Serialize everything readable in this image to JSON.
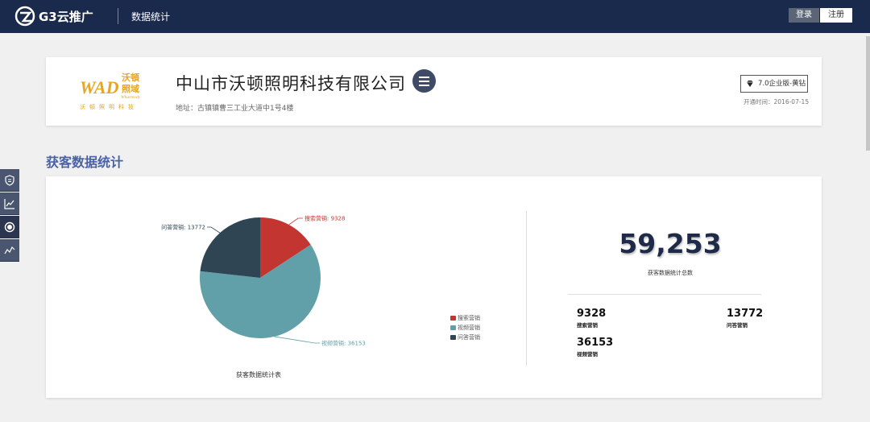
{
  "header": {
    "brand": "G3云推广",
    "page_title": "数据统计",
    "login_label": "登录",
    "register_label": "注册"
  },
  "company": {
    "logo_text_brand": "WAD",
    "logo_text_cn": "沃頓照明科技",
    "logo_text_side": "沃頓 照域",
    "logo_text_en": "Wharteody",
    "name": "中山市沃顿照明科技有限公司",
    "address": "地址：古镇镇曹三工业大道中1号4楼",
    "version": "7.0企业版-黄钻",
    "open_date": "开通时间：2016-07-15"
  },
  "sidebar": {
    "tabs": [
      {
        "icon": "shield-icon"
      },
      {
        "icon": "line-chart-icon"
      },
      {
        "icon": "target-icon"
      },
      {
        "icon": "trend-icon"
      }
    ]
  },
  "section": {
    "title": "获客数据统计"
  },
  "chart_data": {
    "type": "pie",
    "caption": "获客数据统计表",
    "slices": [
      {
        "name": "搜索营销",
        "value": 9328,
        "color": "#c23531",
        "label": "搜索营销: 9328"
      },
      {
        "name": "视频营销",
        "value": 36153,
        "color": "#61a0a8",
        "label": "视频营销: 36153"
      },
      {
        "name": "问答营销",
        "value": 13772,
        "color": "#2f4554",
        "label": "问答营销: 13772"
      }
    ],
    "legend": [
      "搜索营销",
      "视频营销",
      "问答营销"
    ],
    "legend_position": "right-bottom"
  },
  "summary": {
    "total": "59,253",
    "total_label": "获客数据统计总数",
    "items": [
      {
        "value": "9328",
        "label": "搜索营销"
      },
      {
        "value": "13772",
        "label": "问答营销"
      },
      {
        "value": "36153",
        "label": "视频营销"
      }
    ]
  }
}
